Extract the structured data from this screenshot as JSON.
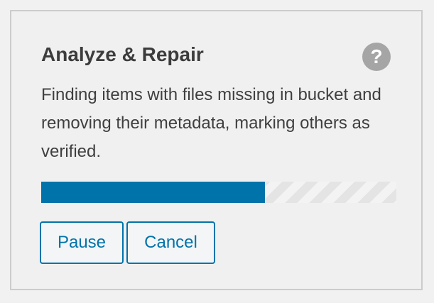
{
  "panel": {
    "title": "Analyze & Repair",
    "help_icon_glyph": "?",
    "help_icon_name": "help-icon",
    "description": "Finding items with files missing in bucket and removing their metadata, marking others as verified."
  },
  "progress": {
    "value_percent": 63,
    "fill_color": "#0073aa",
    "track_pattern": "striped"
  },
  "actions": {
    "pause_label": "Pause",
    "cancel_label": "Cancel"
  },
  "colors": {
    "accent": "#0073aa",
    "help_icon_bg": "#a5a5a5",
    "panel_border": "#cccccc",
    "text": "#3c3c3c"
  }
}
